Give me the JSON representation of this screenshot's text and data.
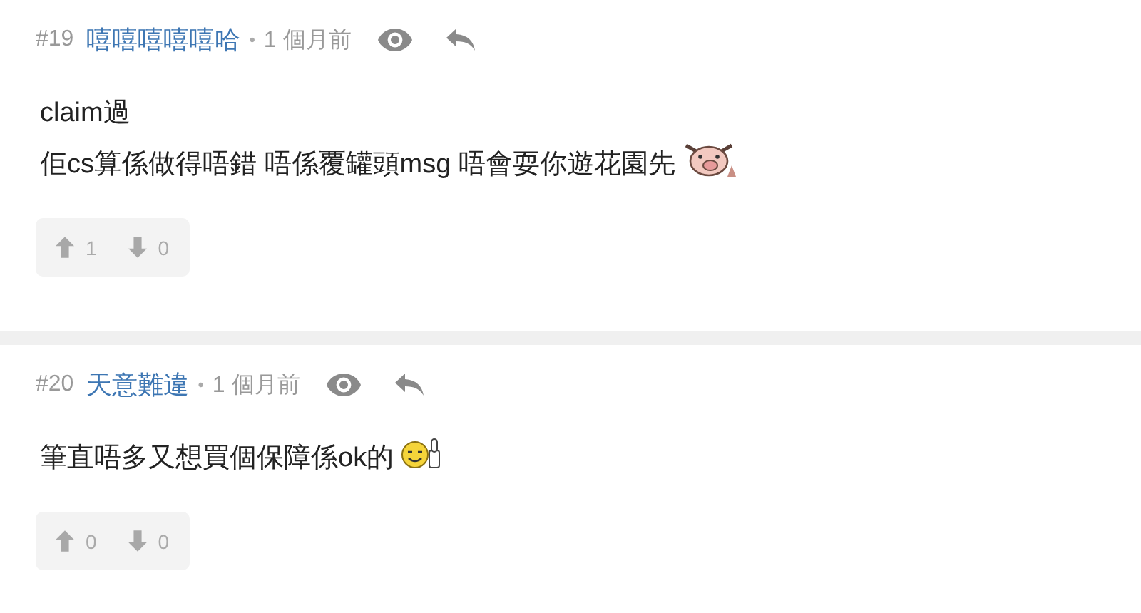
{
  "posts": [
    {
      "number": "#19",
      "author": "嘻嘻嘻嘻嘻哈",
      "separator": "•",
      "time": "1 個月前",
      "lines": [
        "claim過",
        "佢cs算係做得唔錯 唔係覆罐頭msg 唔會耍你遊花園先"
      ],
      "emoji": {
        "kind": "pig"
      },
      "upvotes": "1",
      "downvotes": "0"
    },
    {
      "number": "#20",
      "author": "天意難違",
      "separator": "•",
      "time": "1 個月前",
      "lines": [
        "筆直唔多又想買個保障係ok的"
      ],
      "emoji": {
        "kind": "smiley-thumb"
      },
      "upvotes": "0",
      "downvotes": "0"
    }
  ]
}
